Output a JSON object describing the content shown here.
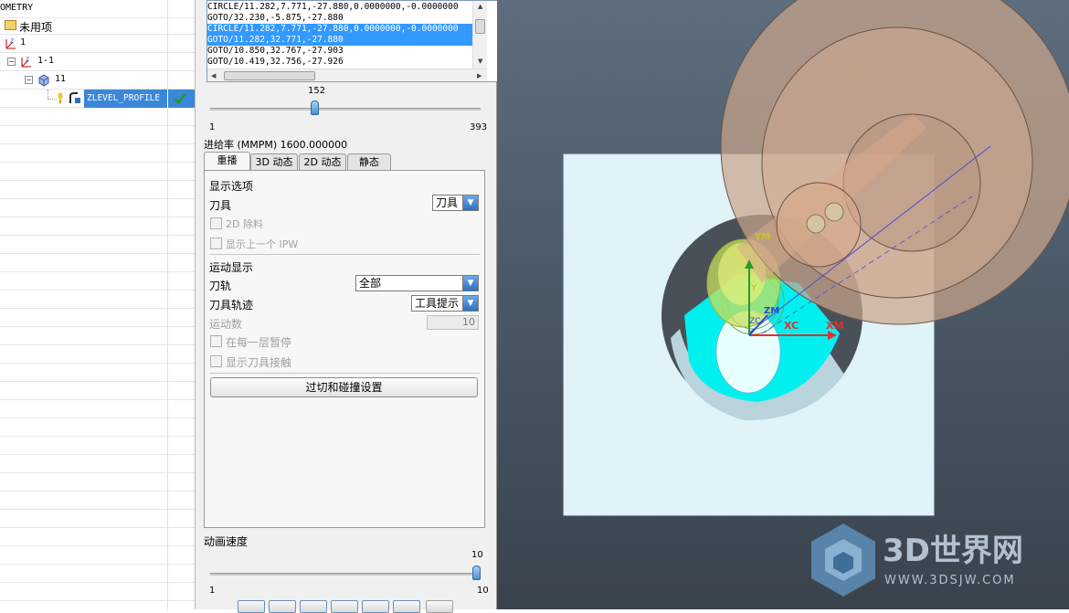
{
  "navigator": {
    "rows": [
      {
        "label": "OMETRY"
      },
      {
        "label": "未用项"
      },
      {
        "label": "1"
      },
      {
        "label": "1-1"
      },
      {
        "label": "11"
      },
      {
        "label": "ZLEVEL_PROFILE",
        "selected": true,
        "status": "check-icon"
      }
    ]
  },
  "toolpath_list": {
    "lines": [
      "CIRCLE/11.282,7.771,-27.880,0.0000000,-0.0000000",
      "GOTO/32.230,-5.875,-27.880",
      "CIRCLE/11.282,7.771,-27.880,0.0000000,-0.0000000",
      "GOTO/11.282,32.771,-27.880",
      "GOTO/10.850,32.767,-27.903",
      "GOTO/10.419,32.756,-27.926"
    ],
    "selected_lines": [
      2,
      3
    ]
  },
  "position_slider": {
    "value": "152",
    "min": "1",
    "max": "393",
    "fraction": 0.385
  },
  "feed_rate": {
    "label": "进给率 (MMPM) 1600.000000"
  },
  "tabs": [
    {
      "label": "重播",
      "active": true
    },
    {
      "label": "3D 动态"
    },
    {
      "label": "2D 动态"
    },
    {
      "label": "静态"
    }
  ],
  "display_options": {
    "heading": "显示选项",
    "tool_label": "刀具",
    "tool_value": "刀具",
    "removal_2d_label": "2D 除料",
    "prev_ipw_label": "显示上一个 IPW"
  },
  "motion_display": {
    "heading": "运动显示",
    "path_label": "刀轨",
    "path_value": "全部",
    "trace_label": "刀具轨迹",
    "trace_value": "工具提示",
    "count_label": "运动数",
    "count_value": "10",
    "pause_label": "在每一层暂停",
    "contact_label": "显示刀具接触",
    "gouge_button": "过切和碰撞设置"
  },
  "anim_speed": {
    "label": "动画速度",
    "value": "10",
    "min": "1",
    "max": "10",
    "fraction": 1.0
  },
  "viewport": {
    "axis_labels": {
      "ym": "YM",
      "y": "Y",
      "zm": "ZM",
      "zc": "ZC",
      "xc": "XC",
      "xm": "XM"
    },
    "watermark": {
      "title": "3D世界网",
      "url": "WWW.3DSJW.COM"
    },
    "colors": {
      "bg_top": "#5e6e7e",
      "stock": "#e0f3f8",
      "cylinder": "#c9a58c",
      "cyan": "#00f0f0"
    }
  }
}
